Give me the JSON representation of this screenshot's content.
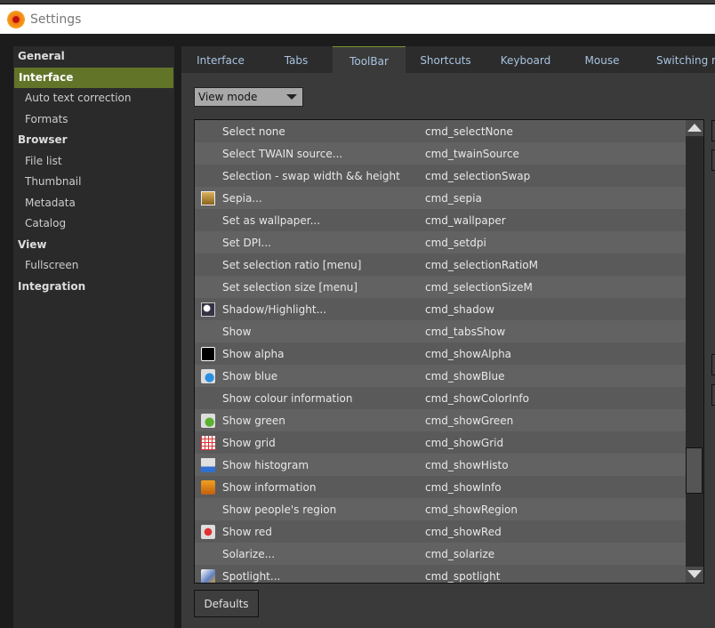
{
  "window": {
    "title": "Settings"
  },
  "sidebar": {
    "items": [
      {
        "label": "General",
        "type": "h"
      },
      {
        "label": "Interface",
        "type": "sel"
      },
      {
        "label": "Auto text correction",
        "type": "sub"
      },
      {
        "label": "Formats",
        "type": "sub"
      },
      {
        "label": "Browser",
        "type": "h"
      },
      {
        "label": "File list",
        "type": "sub"
      },
      {
        "label": "Thumbnail",
        "type": "sub"
      },
      {
        "label": "Metadata",
        "type": "sub"
      },
      {
        "label": "Catalog",
        "type": "sub"
      },
      {
        "label": "View",
        "type": "h"
      },
      {
        "label": "Fullscreen",
        "type": "sub"
      },
      {
        "label": "Integration",
        "type": "h"
      }
    ]
  },
  "tabs": [
    {
      "label": "Interface"
    },
    {
      "label": "Tabs"
    },
    {
      "label": "ToolBar",
      "active": true
    },
    {
      "label": "Shortcuts"
    },
    {
      "label": "Keyboard"
    },
    {
      "label": "Mouse"
    },
    {
      "label": "Switching m"
    }
  ],
  "view_mode": {
    "selected": "View mode"
  },
  "commands": [
    {
      "name": "Select none",
      "cmd": "cmd_selectNone",
      "icon": ""
    },
    {
      "name": "Select TWAIN source...",
      "cmd": "cmd_twainSource",
      "icon": ""
    },
    {
      "name": "Selection - swap width && height",
      "cmd": "cmd_selectionSwap",
      "icon": ""
    },
    {
      "name": "Sepia...",
      "cmd": "cmd_sepia",
      "icon": "sepia-icon"
    },
    {
      "name": "Set as wallpaper...",
      "cmd": "cmd_wallpaper",
      "icon": ""
    },
    {
      "name": "Set DPI...",
      "cmd": "cmd_setdpi",
      "icon": ""
    },
    {
      "name": "Set selection ratio [menu]",
      "cmd": "cmd_selectionRatioM",
      "icon": ""
    },
    {
      "name": "Set selection size [menu]",
      "cmd": "cmd_selectionSizeM",
      "icon": ""
    },
    {
      "name": "Shadow/Highlight...",
      "cmd": "cmd_shadow",
      "icon": "shadow-highlight-icon"
    },
    {
      "name": "Show",
      "cmd": "cmd_tabsShow",
      "icon": ""
    },
    {
      "name": "Show alpha",
      "cmd": "cmd_showAlpha",
      "icon": "alpha-icon"
    },
    {
      "name": "Show blue",
      "cmd": "cmd_showBlue",
      "icon": "blue-channel-icon"
    },
    {
      "name": "Show colour information",
      "cmd": "cmd_showColorInfo",
      "icon": ""
    },
    {
      "name": "Show green",
      "cmd": "cmd_showGreen",
      "icon": "green-channel-icon"
    },
    {
      "name": "Show grid",
      "cmd": "cmd_showGrid",
      "icon": "grid-icon"
    },
    {
      "name": "Show histogram",
      "cmd": "cmd_showHisto",
      "icon": "histogram-icon"
    },
    {
      "name": "Show information",
      "cmd": "cmd_showInfo",
      "icon": "information-icon"
    },
    {
      "name": "Show people's region",
      "cmd": "cmd_showRegion",
      "icon": ""
    },
    {
      "name": "Show red",
      "cmd": "cmd_showRed",
      "icon": "red-channel-icon"
    },
    {
      "name": "Solarize...",
      "cmd": "cmd_solarize",
      "icon": ""
    },
    {
      "name": "Spotlight...",
      "cmd": "cmd_spotlight",
      "icon": "spotlight-icon"
    }
  ],
  "buttons": {
    "defaults": "Defaults"
  },
  "scroll": {
    "position_fraction": 0.82
  }
}
